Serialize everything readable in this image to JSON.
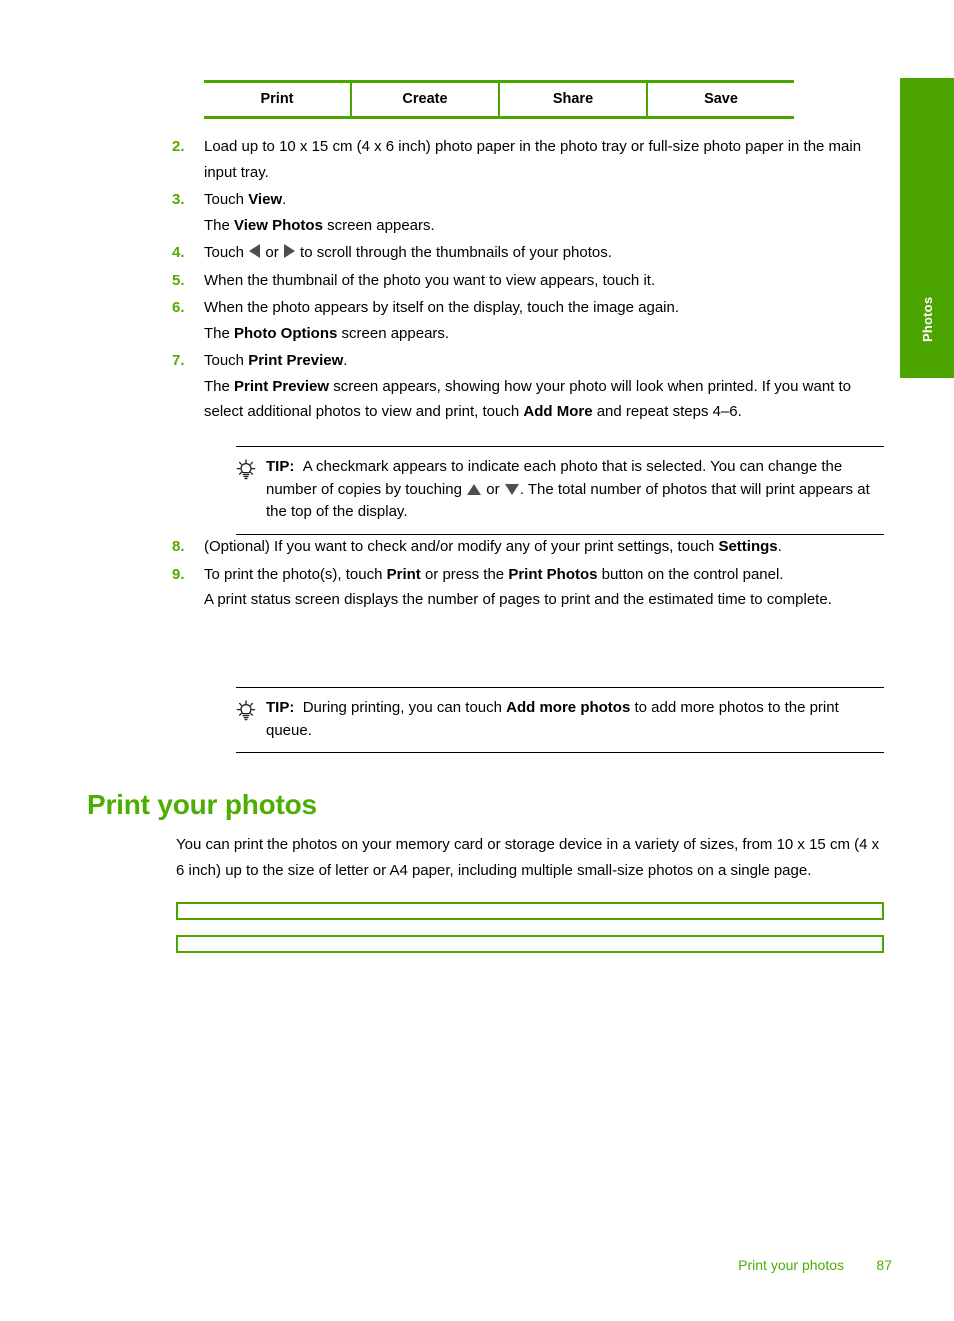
{
  "side_tab": {
    "label": "Photos",
    "color": "#4ca400"
  },
  "nav_table": {
    "cells": [
      {
        "label": "Print"
      },
      {
        "label": "Create"
      },
      {
        "label": "Share"
      },
      {
        "label": "Save"
      }
    ],
    "border_color": "#4ca400"
  },
  "steps": [
    {
      "number": "2.",
      "lines": [
        "Load up to 10 x 15 cm (4 x 6 inch) photo paper in the photo tray or full-size photo paper in the main input tray."
      ]
    },
    {
      "number": "3.",
      "line1_pre": "Touch ",
      "line1_bold": "View",
      "line1_post": ".",
      "line2_pre": "The ",
      "line2_bold": "View Photos",
      "line2_post": " screen appears."
    },
    {
      "number": "4.",
      "pre": "Touch ",
      "mid": " or ",
      "post": " to scroll through the thumbnails of your photos."
    },
    {
      "number": "5.",
      "text": "When the thumbnail of the photo you want to view appears, touch it."
    },
    {
      "number": "6.",
      "line1": "When the photo appears by itself on the display, touch the image again.",
      "line2_pre": "The ",
      "line2_bold": "Photo Options",
      "line2_post": " screen appears."
    },
    {
      "number": "7.",
      "line1_pre": "Touch ",
      "line1_bold": "Print Preview",
      "line1_post": ".",
      "line2_pre": "The ",
      "line2_bold": "Print Preview",
      "line2_mid": " screen appears, showing how your photo will look when printed. If you want to select additional photos to view and print, touch ",
      "line2_bold2": "Add More",
      "line2_post": " and repeat steps 4–6."
    },
    {
      "number": "8.",
      "pre": "(Optional) If you want to check and/or modify any of your print settings, touch ",
      "bold": "Settings",
      "post": "."
    },
    {
      "number": "9.",
      "line1_pre": "To print the photo(s), touch ",
      "line1_bold": "Print",
      "line1_mid": " or press the ",
      "line1_bold2": "Print Photos",
      "line1_post": " button on the control panel.",
      "line2": "A print status screen displays the number of pages to print and the estimated time to complete."
    }
  ],
  "tips": [
    {
      "icon": "lightbulb-icon",
      "label": "TIP:",
      "pre": "A checkmark appears to indicate each photo that is selected. You can change the number of copies by touching ",
      "mid": " or ",
      "post": ". The total number of photos that will print appears at the top of the display."
    },
    {
      "icon": "lightbulb-icon",
      "label": "TIP:",
      "pre": "During printing, you can touch ",
      "bold": "Add more photos",
      "post": " to add more photos to the print queue."
    }
  ],
  "section": {
    "heading": "Print your photos",
    "heading_color": "#4cae00",
    "paragraph": "You can print the photos on your memory card or storage device in a variety of sizes, from 10 x 15 cm (4 x 6 inch) up to the size of letter or A4 paper, including multiple small-size photos on a single page."
  },
  "footer": {
    "title": "Print your photos",
    "page_number": "87",
    "color": "#4cae00"
  }
}
